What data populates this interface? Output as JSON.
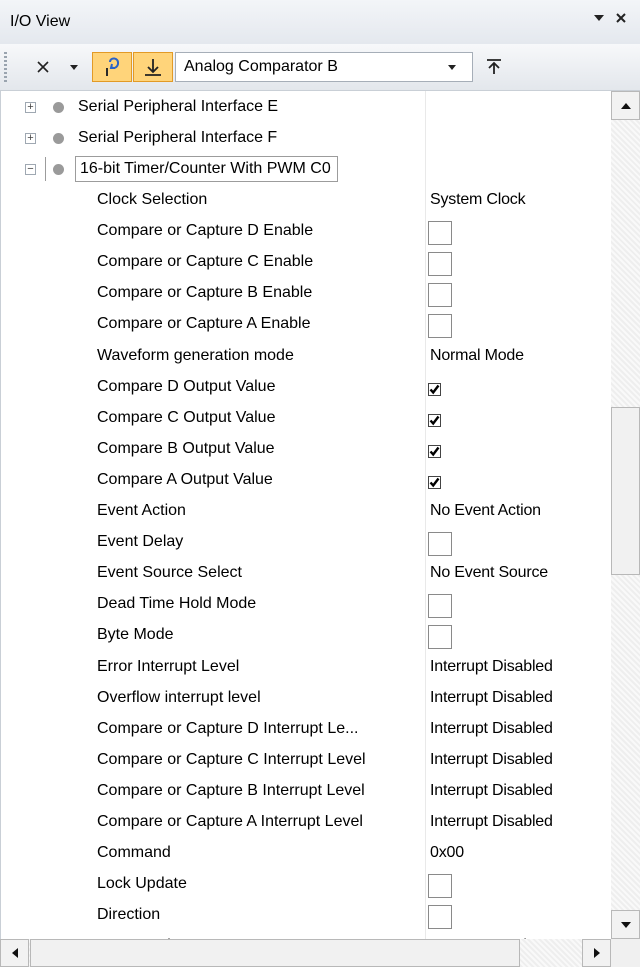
{
  "window": {
    "title": "I/O View",
    "menu_icon": "chevron-down-icon",
    "close_icon": "close-icon"
  },
  "toolbar": {
    "buttons": [
      {
        "name": "close-x-icon"
      },
      {
        "name": "dropdown-arrow-icon"
      },
      {
        "name": "refresh-bits-icon",
        "active": true
      },
      {
        "name": "break-on-change-icon",
        "active": true
      }
    ],
    "module_select": "Analog Comparator B",
    "pin_icon": "pin-to-top-icon"
  },
  "tree": {
    "modules": [
      {
        "label": "Serial Peripheral Interface E",
        "expander": "+"
      },
      {
        "label": "Serial Peripheral Interface F",
        "expander": "+"
      },
      {
        "label": "16-bit Timer/Counter With PWM C0",
        "expander": "−"
      }
    ],
    "properties": [
      {
        "name": "Clock Selection",
        "value": "System Clock",
        "type": "text"
      },
      {
        "name": "Compare or Capture D Enable",
        "type": "checkbox",
        "checked": false
      },
      {
        "name": "Compare or Capture C Enable",
        "type": "checkbox",
        "checked": false
      },
      {
        "name": "Compare or Capture B Enable",
        "type": "checkbox",
        "checked": false
      },
      {
        "name": "Compare or Capture A Enable",
        "type": "checkbox",
        "checked": false
      },
      {
        "name": "Waveform generation mode",
        "value": "Normal Mode",
        "type": "text"
      },
      {
        "name": "Compare D Output Value",
        "type": "checkbox",
        "checked": true
      },
      {
        "name": "Compare C Output Value",
        "type": "checkbox",
        "checked": true
      },
      {
        "name": "Compare B Output Value",
        "type": "checkbox",
        "checked": true
      },
      {
        "name": "Compare A Output Value",
        "type": "checkbox",
        "checked": true
      },
      {
        "name": "Event Action",
        "value": "No Event Action",
        "type": "text"
      },
      {
        "name": "Event Delay",
        "type": "checkbox",
        "checked": false
      },
      {
        "name": "Event Source Select",
        "value": "No Event Source",
        "type": "text"
      },
      {
        "name": "Dead Time Hold Mode",
        "type": "checkbox",
        "checked": false
      },
      {
        "name": "Byte Mode",
        "type": "checkbox",
        "checked": false
      },
      {
        "name": "Error Interrupt Level",
        "value": "Interrupt Disabled",
        "type": "text"
      },
      {
        "name": "Overflow interrupt level",
        "value": "Interrupt Disabled",
        "type": "text"
      },
      {
        "name": "Compare or Capture D Interrupt Le...",
        "value": "Interrupt Disabled",
        "type": "text"
      },
      {
        "name": "Compare or Capture C Interrupt Level",
        "value": "Interrupt Disabled",
        "type": "text"
      },
      {
        "name": "Compare or Capture B Interrupt Level",
        "value": "Interrupt Disabled",
        "type": "text"
      },
      {
        "name": "Compare or Capture A Interrupt Level",
        "value": "Interrupt Disabled",
        "type": "text"
      },
      {
        "name": "Command",
        "value": "0x00",
        "type": "text"
      },
      {
        "name": "Lock Update",
        "type": "checkbox",
        "checked": false
      },
      {
        "name": "Direction",
        "type": "checkbox",
        "checked": false
      },
      {
        "name": "Command",
        "value": "No Command",
        "type": "text"
      }
    ]
  },
  "scrollbars": {
    "vertical": {
      "up_icon": "scroll-up-icon",
      "down_icon": "scroll-down-icon"
    },
    "horizontal": {
      "left_icon": "scroll-left-icon",
      "right_icon": "scroll-right-icon"
    }
  }
}
